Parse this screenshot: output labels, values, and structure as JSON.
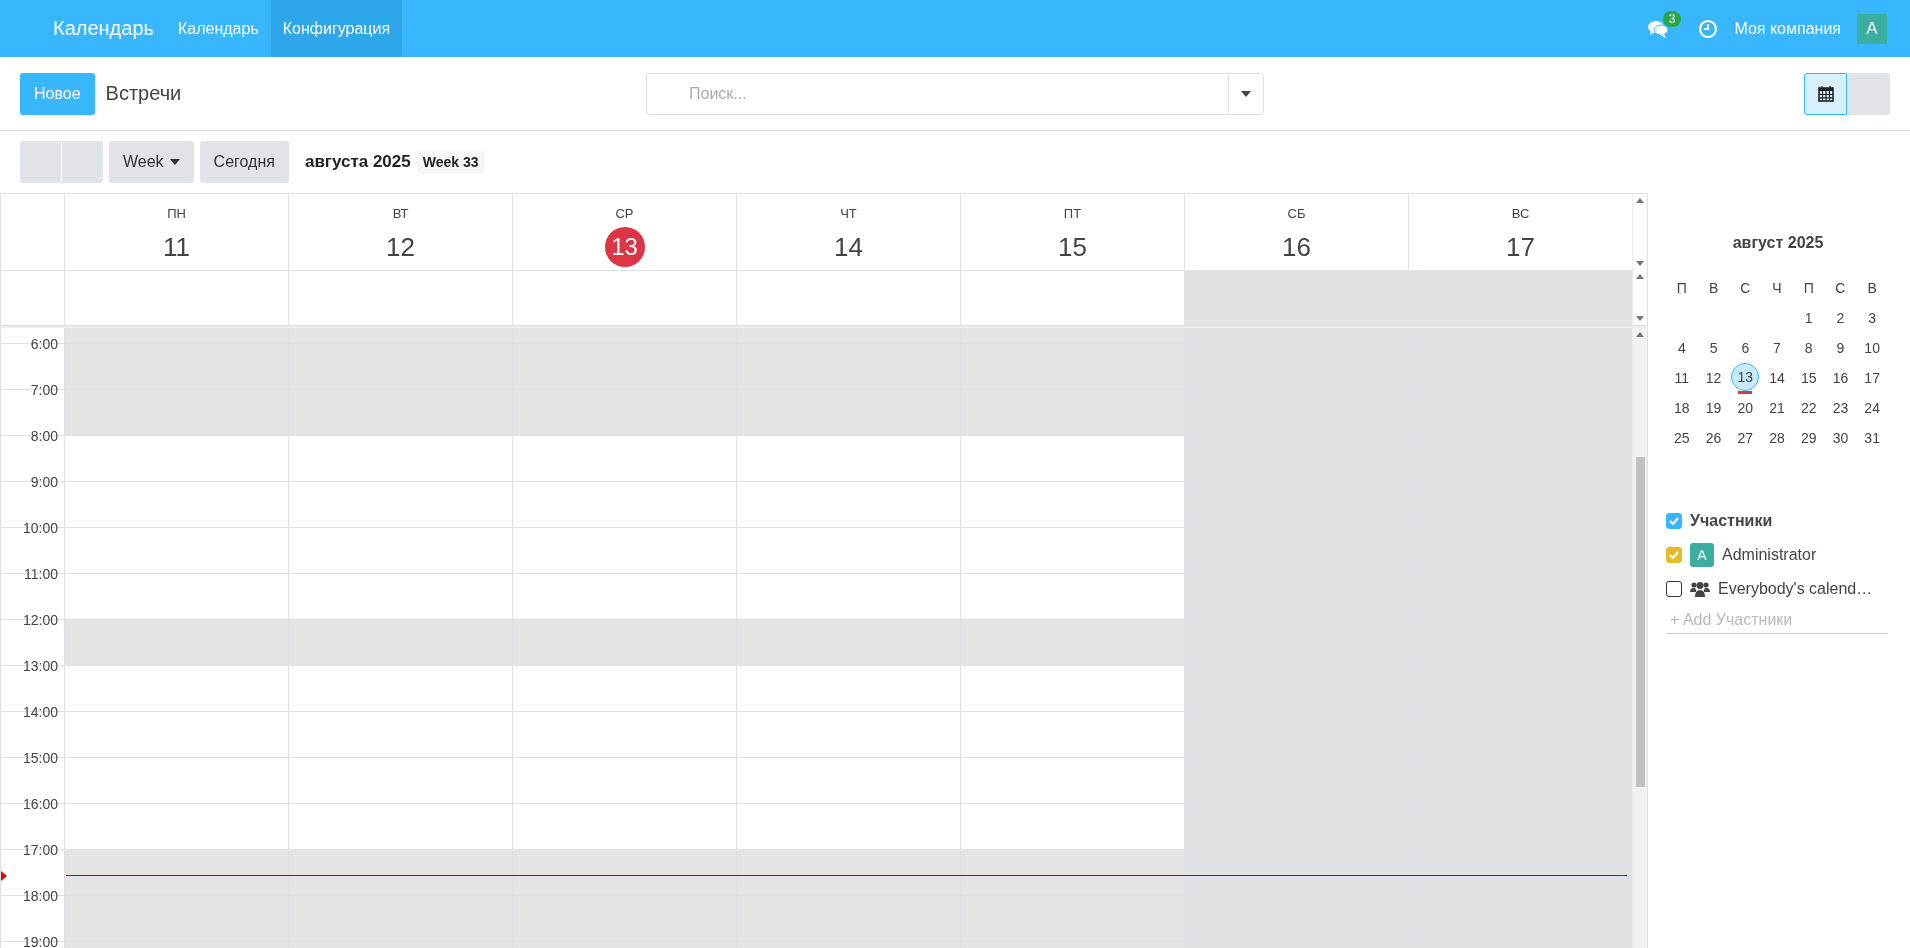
{
  "topbar": {
    "app_name": "Календарь",
    "menu": [
      {
        "label": "Календарь",
        "selected": false
      },
      {
        "label": "Конфигурация",
        "selected": true
      }
    ],
    "messages_badge": "3",
    "company": "Моя компания",
    "avatar": "A"
  },
  "control_panel": {
    "new_button": "Новое",
    "title": "Встречи",
    "search": {
      "placeholder": "Поиск..."
    },
    "views": [
      {
        "kind": "calendar",
        "selected": true
      },
      {
        "kind": "other",
        "selected": false
      }
    ]
  },
  "toolbar": {
    "scale": "Week",
    "today": "Сегодня",
    "period": "августа 2025",
    "week_badge": "Week 33"
  },
  "days": [
    {
      "weekday": "ПН",
      "date": "11",
      "today": false,
      "weekend": false
    },
    {
      "weekday": "ВТ",
      "date": "12",
      "today": false,
      "weekend": false
    },
    {
      "weekday": "СР",
      "date": "13",
      "today": true,
      "weekend": false
    },
    {
      "weekday": "ЧТ",
      "date": "14",
      "today": false,
      "weekend": false
    },
    {
      "weekday": "ПТ",
      "date": "15",
      "today": false,
      "weekend": false
    },
    {
      "weekday": "СБ",
      "date": "16",
      "today": false,
      "weekend": true
    },
    {
      "weekday": "ВС",
      "date": "17",
      "today": false,
      "weekend": true
    }
  ],
  "hours": [
    {
      "off_hours": true,
      "now": false
    },
    {
      "label": "6:00",
      "off_hours": true,
      "now": false
    },
    {
      "label": "7:00",
      "off_hours": true,
      "now": false
    },
    {
      "label": "8:00",
      "off_hours": false,
      "now": false
    },
    {
      "label": "9:00",
      "off_hours": false,
      "now": false
    },
    {
      "label": "10:00",
      "off_hours": false,
      "now": false
    },
    {
      "label": "11:00",
      "off_hours": false,
      "now": false
    },
    {
      "label": "12:00",
      "off_hours": true,
      "now": false
    },
    {
      "label": "13:00",
      "off_hours": false,
      "now": false
    },
    {
      "label": "14:00",
      "off_hours": false,
      "now": false
    },
    {
      "label": "15:00",
      "off_hours": false,
      "now": false
    },
    {
      "label": "16:00",
      "off_hours": false,
      "now": false
    },
    {
      "label": "17:00",
      "off_hours": true,
      "now": true
    },
    {
      "label": "18:00",
      "off_hours": true,
      "now": false
    },
    {
      "label": "19:00",
      "off_hours": true,
      "now": false
    }
  ],
  "sidebar": {
    "month": "август 2025",
    "weekdays": [
      "П",
      "В",
      "С",
      "Ч",
      "П",
      "С",
      "В"
    ],
    "weeks": [
      [
        {
          "d": "1",
          "selected": false
        },
        {
          "d": "2",
          "selected": false
        },
        {
          "d": "3",
          "selected": false
        }
      ],
      [
        {
          "d": "4",
          "selected": false
        },
        {
          "d": "5",
          "selected": false
        },
        {
          "d": "6",
          "selected": false
        },
        {
          "d": "7",
          "selected": false
        },
        {
          "d": "8",
          "selected": false
        },
        {
          "d": "9",
          "selected": false
        },
        {
          "d": "10",
          "selected": false
        }
      ],
      [
        {
          "d": "11",
          "selected": false
        },
        {
          "d": "12",
          "selected": false
        },
        {
          "d": "13",
          "selected": true
        },
        {
          "d": "14",
          "selected": false
        },
        {
          "d": "15",
          "selected": false
        },
        {
          "d": "16",
          "selected": false
        },
        {
          "d": "17",
          "selected": false
        }
      ],
      [
        {
          "d": "18",
          "selected": false
        },
        {
          "d": "19",
          "selected": false
        },
        {
          "d": "20",
          "selected": false
        },
        {
          "d": "21",
          "selected": false
        },
        {
          "d": "22",
          "selected": false
        },
        {
          "d": "23",
          "selected": false
        },
        {
          "d": "24",
          "selected": false
        }
      ],
      [
        {
          "d": "25",
          "selected": false
        },
        {
          "d": "26",
          "selected": false
        },
        {
          "d": "27",
          "selected": false
        },
        {
          "d": "28",
          "selected": false
        },
        {
          "d": "29",
          "selected": false
        },
        {
          "d": "30",
          "selected": false
        },
        {
          "d": "31",
          "selected": false
        }
      ]
    ],
    "filters": [
      {
        "kind": "header",
        "label": "Участники",
        "checked": true,
        "color": "#38b6ff"
      },
      {
        "kind": "person",
        "label": "Administrator",
        "avatar": "A",
        "checked": true,
        "color": "#e6bb25"
      },
      {
        "kind": "group",
        "label": "Everybody's calend…",
        "checked": false
      }
    ],
    "add_placeholder": "+ Add Участники"
  }
}
